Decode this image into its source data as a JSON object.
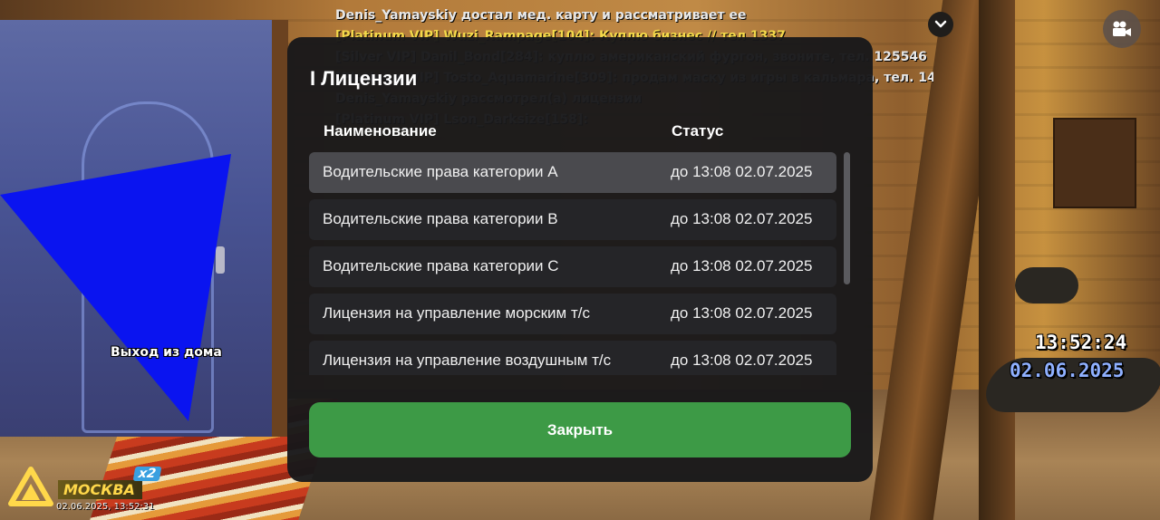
{
  "chat": {
    "lines": [
      {
        "text": "Denis_Yamayskiy достал мед. карту и рассматривает ее",
        "color": "white"
      },
      {
        "text": "[Platinum VIP] Wuzi_Rampage[104]: Куплю бизнес // тел 1337",
        "color": "yellow"
      },
      {
        "text": "[Silver VIP] Danil_Bond[284]: куплю американский фургон, звоните, тел. 125546",
        "color": "white"
      },
      {
        "text": "[Platinum VIP] Tosto_Aquamarine[309]: продам маску из игры в кальмара, тел. 148783",
        "color": "white"
      },
      {
        "text": "Denis_Yamayskiy рассмотрел(а) лицензии",
        "color": "white"
      },
      {
        "text": "[Platinum VIP] Lson_Darksize[158]:",
        "color": "white"
      }
    ]
  },
  "scene": {
    "exit_label": "Выход из дома"
  },
  "hud": {
    "time": "13:52:24",
    "date": "02.06.2025",
    "chevron_icon": "chevron-down-icon",
    "camera_icon": "video-camera-icon"
  },
  "server": {
    "name": "МОСКВА",
    "multiplier": "x2",
    "stamp": "02.06.2025, 13:52:31"
  },
  "modal": {
    "title": "I Лицензии",
    "columns": {
      "name": "Наименование",
      "status": "Статус"
    },
    "rows": [
      {
        "name": "Водительские права категории A",
        "status": "до 13:08 02.07.2025"
      },
      {
        "name": "Водительские права категории B",
        "status": "до 13:08 02.07.2025"
      },
      {
        "name": "Водительские права категории C",
        "status": "до 13:08 02.07.2025"
      },
      {
        "name": "Лицензия на управление морским т/с",
        "status": "до 13:08 02.07.2025"
      },
      {
        "name": "Лицензия на управление воздушным т/с",
        "status": "до 13:08 02.07.2025"
      }
    ],
    "close_label": "Закрыть",
    "colors": {
      "accent": "#3d9a46",
      "panel": "#18181a",
      "row": "#252528",
      "row_selected": "#4a4a4e"
    }
  }
}
